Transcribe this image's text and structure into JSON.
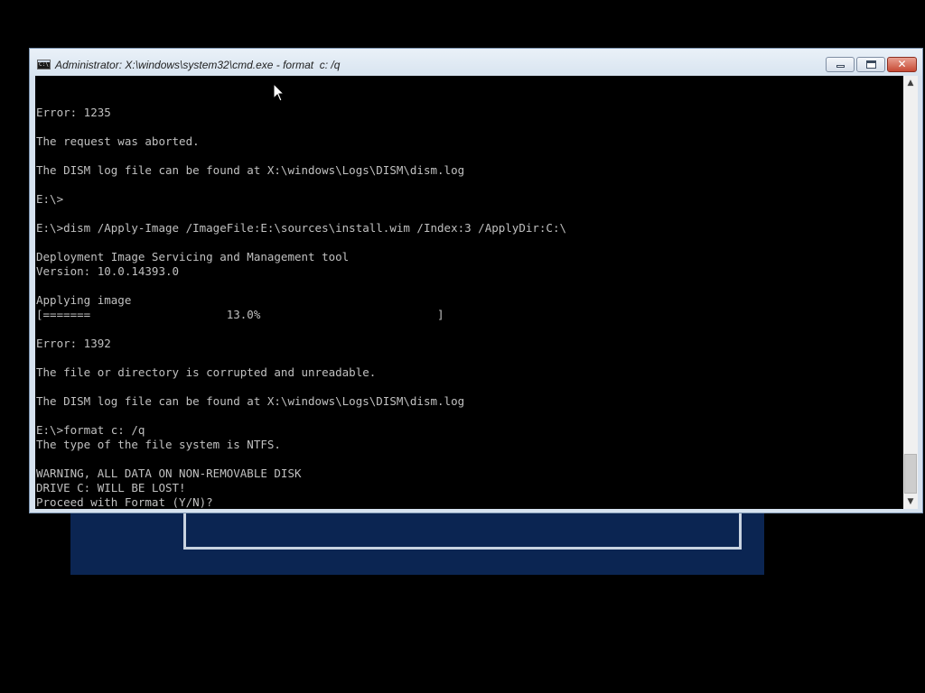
{
  "window": {
    "title": "Administrator: X:\\windows\\system32\\cmd.exe - format  c: /q",
    "icon": "cmd-icon",
    "icon_text": "C:\\",
    "controls": {
      "minimize": "minimize-icon",
      "maximize": "maximize-icon",
      "close": "close-icon",
      "close_glyph": "✕"
    }
  },
  "console": {
    "lines": [
      "Error: 1235",
      "",
      "The request was aborted.",
      "",
      "The DISM log file can be found at X:\\windows\\Logs\\DISM\\dism.log",
      "",
      "E:\\>",
      "",
      "E:\\>dism /Apply-Image /ImageFile:E:\\sources\\install.wim /Index:3 /ApplyDir:C:\\",
      "",
      "Deployment Image Servicing and Management tool",
      "Version: 10.0.14393.0",
      "",
      "Applying image",
      "[=======                    13.0%                          ]",
      "",
      "Error: 1392",
      "",
      "The file or directory is corrupted and unreadable.",
      "",
      "The DISM log file can be found at X:\\windows\\Logs\\DISM\\dism.log",
      "",
      "E:\\>format c: /q",
      "The type of the file system is NTFS.",
      "",
      "WARNING, ALL DATA ON NON-REMOVABLE DISK",
      "DRIVE C: WILL BE LOST!",
      "Proceed with Format (Y/N)?"
    ]
  },
  "scrollbar": {
    "up_arrow": "▲",
    "down_arrow": "▼",
    "position_fraction": 0.95
  },
  "colors": {
    "console_background": "#000000",
    "console_text": "#c0c0c0",
    "setup_background": "#0b2552",
    "close_button": "#c74a34"
  }
}
